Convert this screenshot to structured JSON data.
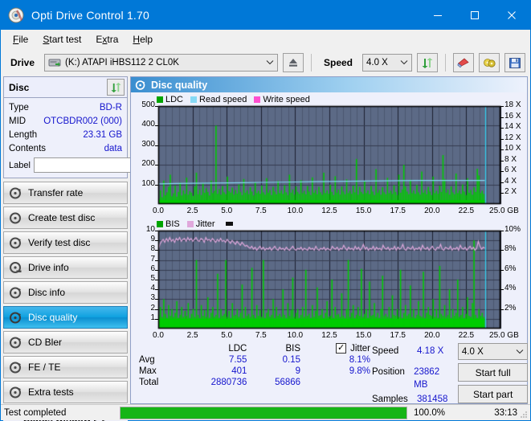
{
  "window": {
    "title": "Opti Drive Control 1.70",
    "icon": "disc-icon",
    "minimize": "–",
    "maximize": "☐",
    "close": "✕"
  },
  "menu": [
    {
      "label": "File",
      "accel": "F"
    },
    {
      "label": "Start test",
      "accel": "S"
    },
    {
      "label": "Extra",
      "accel": "x"
    },
    {
      "label": "Help",
      "accel": "H"
    }
  ],
  "toolbar": {
    "drive_label": "Drive",
    "drive_value": "(K:)  ATAPI iHBS112  2 CL0K",
    "eject_icon": "eject-icon",
    "speed_label": "Speed",
    "speed_value": "4.0 X",
    "refresh_icon": "refresh-icon",
    "eraser_icon": "eraser-icon",
    "disc_tools_icon": "disc-tools-icon",
    "save_icon": "save-icon",
    "caret": "⌄"
  },
  "disc_panel": {
    "title": "Disc",
    "refresh_icon": "refresh-icon",
    "rows": [
      {
        "key": "Type",
        "value": "BD-R"
      },
      {
        "key": "MID",
        "value": "OTCBDR002 (000)"
      },
      {
        "key": "Length",
        "value": "23.31 GB"
      },
      {
        "key": "Contents",
        "value": "data"
      }
    ],
    "label_key": "Label",
    "label_value": "",
    "label_placeholder": "",
    "label_button_icon": "disc-icon"
  },
  "nav": {
    "items": [
      {
        "label": "Transfer rate",
        "icon": "disc-transfer-icon",
        "active": false
      },
      {
        "label": "Create test disc",
        "icon": "disc-create-icon",
        "active": false
      },
      {
        "label": "Verify test disc",
        "icon": "disc-verify-icon",
        "active": false
      },
      {
        "label": "Drive info",
        "icon": "disc-drive-icon",
        "active": false
      },
      {
        "label": "Disc info",
        "icon": "disc-info-icon",
        "active": false
      },
      {
        "label": "Disc quality",
        "icon": "disc-quality-icon",
        "active": true
      },
      {
        "label": "CD Bler",
        "icon": "disc-bler-icon",
        "active": false
      },
      {
        "label": "FE / TE",
        "icon": "disc-fete-icon",
        "active": false
      },
      {
        "label": "Extra tests",
        "icon": "disc-extra-icon",
        "active": false
      }
    ],
    "status_window": "Status window > >"
  },
  "panel": {
    "title": "Disc quality",
    "icon": "disc-quality-icon"
  },
  "stats": {
    "columns": [
      "LDC",
      "BIS"
    ],
    "jitter_label": "Jitter",
    "jitter_checked": true,
    "jitter_check_glyph": "✓",
    "rows": [
      {
        "key": "Avg",
        "ldc": "7.55",
        "bis": "0.15",
        "jitter": "8.1%"
      },
      {
        "key": "Max",
        "ldc": "401",
        "bis": "9",
        "jitter": "9.8%"
      },
      {
        "key": "Total",
        "ldc": "2880736",
        "bis": "56866",
        "jitter": ""
      }
    ],
    "speed_key": "Speed",
    "speed_value": "4.18 X",
    "position_key": "Position",
    "position_value": "23862 MB",
    "samples_key": "Samples",
    "samples_value": "381458",
    "speed_select": "4.0 X",
    "speed_select_caret": "⌄",
    "start_full": "Start full",
    "start_part": "Start part"
  },
  "statusbar": {
    "text": "Test completed",
    "percent_label": "100.0%",
    "percent_value": 100,
    "time": "33:13",
    "bar_color": "#16b516"
  },
  "colors": {
    "accent": "#0078d7",
    "plot_bg": "#5c6a86",
    "grid": "#2c3242",
    "ldc": "#00cc00",
    "bis": "#00cc00",
    "read_speed": "#87d9f5",
    "write_speed": "#ff4fd0",
    "jitter": "#e0a8dc",
    "marker": "#30d0f0",
    "value_text": "#1515cd"
  },
  "chart_data": [
    {
      "type": "line",
      "name": "Disc quality - LDC / Read speed",
      "title": "",
      "xlabel": "GB",
      "ylabel": "LDC",
      "y2label": "X",
      "xlim": [
        0,
        25
      ],
      "ylim": [
        0,
        500
      ],
      "y2lim": [
        0,
        18
      ],
      "grid": true,
      "legend": [
        {
          "label": "LDC",
          "color": "#00a400"
        },
        {
          "label": "Read speed",
          "color": "#87d9f5"
        },
        {
          "label": "Write speed",
          "color": "#ff4fd0"
        }
      ],
      "xticks": [
        "0.0",
        "2.5",
        "5.0",
        "7.5",
        "10.0",
        "12.5",
        "15.0",
        "17.5",
        "20.0",
        "22.5",
        "25.0"
      ],
      "xtick_values": [
        0,
        2.5,
        5,
        7.5,
        10,
        12.5,
        15,
        17.5,
        20,
        22.5,
        25
      ],
      "x_unit": "GB",
      "yticks": [
        100,
        200,
        300,
        400,
        500
      ],
      "y2ticks": [
        2,
        4,
        6,
        8,
        10,
        12,
        14,
        16,
        18
      ],
      "y2tick_labels": [
        "2 X",
        "4 X",
        "6 X",
        "8 X",
        "10 X",
        "12 X",
        "14 X",
        "16 X",
        "18 X"
      ],
      "data_end_x": 23.86,
      "marker_x": 23.86,
      "series": [
        {
          "name": "LDC",
          "kind": "impulse",
          "color": "#00cc00",
          "x_start": 0,
          "x_end": 23.86,
          "baseline": 20,
          "values": [
            28,
            70,
            35,
            120,
            45,
            60,
            88,
            150,
            40,
            55,
            95,
            38,
            62,
            110,
            44,
            70,
            52,
            135,
            48,
            66,
            58,
            42,
            90,
            160,
            50,
            74,
            46,
            105,
            58,
            80,
            62,
            44,
            120,
            56,
            68,
            400,
            52,
            76,
            48,
            92,
            60,
            50,
            140,
            66,
            58,
            84,
            48,
            72,
            54,
            100,
            62,
            46,
            128,
            58,
            70,
            50,
            86,
            64,
            44,
            110,
            56,
            68,
            52,
            94,
            60,
            48,
            132,
            58,
            72,
            46,
            88,
            64,
            50,
            118,
            56,
            70,
            52,
            96,
            60,
            46,
            150,
            58,
            74,
            48,
            90,
            62,
            52,
            122,
            56,
            68,
            50,
            92,
            64,
            46,
            136,
            58,
            72,
            50,
            88,
            60,
            48,
            160,
            56,
            70,
            52,
            98,
            62,
            46,
            142,
            58,
            74,
            48,
            90,
            64,
            50,
            126,
            56,
            68,
            52,
            94,
            60,
            230,
            48,
            88,
            62,
            52,
            118,
            56,
            70,
            50,
            92,
            64,
            46,
            178,
            58,
            72,
            48,
            86,
            60,
            50,
            134,
            56,
            68,
            52,
            96,
            62,
            46,
            150,
            58,
            74,
            200,
            90,
            64,
            50,
            124,
            56,
            70,
            52,
            98,
            60,
            48,
            166,
            58,
            72,
            50,
            88,
            64,
            46,
            140,
            56,
            68,
            52,
            94,
            62,
            250,
            128,
            58,
            74,
            48,
            90,
            60,
            50,
            156,
            56,
            70,
            52,
            100,
            64,
            46,
            132,
            58,
            72,
            48,
            86,
            62,
            180,
            146,
            56,
            68,
            52
          ]
        },
        {
          "name": "Read speed",
          "kind": "line",
          "color": "#87d9f5",
          "x_start": 0,
          "x_end": 23.86,
          "values_x_units": [
            3.7,
            3.78,
            3.82,
            3.86,
            3.9,
            3.94,
            3.98,
            4.02,
            4.06,
            4.1,
            4.14,
            4.18,
            4.22,
            4.26,
            4.3,
            4.32,
            4.34,
            4.34,
            4.34,
            4.34
          ]
        },
        {
          "name": "Write speed",
          "kind": "line",
          "color": "#ff4fd0",
          "values": []
        }
      ]
    },
    {
      "type": "line",
      "name": "Disc quality - BIS / Jitter",
      "title": "",
      "xlabel": "GB",
      "ylabel": "BIS",
      "y2label": "%",
      "xlim": [
        0,
        25
      ],
      "ylim": [
        0,
        10
      ],
      "y2lim": [
        0,
        10
      ],
      "grid": true,
      "legend": [
        {
          "label": "BIS",
          "color": "#00a400"
        },
        {
          "label": "Jitter",
          "color": "#e0a8dc"
        }
      ],
      "xticks": [
        "0.0",
        "2.5",
        "5.0",
        "7.5",
        "10.0",
        "12.5",
        "15.0",
        "17.5",
        "20.0",
        "22.5",
        "25.0"
      ],
      "xtick_values": [
        0,
        2.5,
        5,
        7.5,
        10,
        12.5,
        15,
        17.5,
        20,
        22.5,
        25
      ],
      "x_unit": "GB",
      "yticks": [
        1,
        2,
        3,
        4,
        5,
        6,
        7,
        8,
        9,
        10
      ],
      "y2ticks": [
        2,
        4,
        6,
        8,
        10
      ],
      "y2tick_labels": [
        "2%",
        "4%",
        "6%",
        "8%",
        "10%"
      ],
      "data_end_x": 23.86,
      "marker_x": 23.86,
      "series": [
        {
          "name": "BIS",
          "kind": "impulse",
          "color": "#00cc00",
          "x_start": 0,
          "x_end": 23.86,
          "baseline": 1.0,
          "values": [
            1.4,
            2.2,
            1.2,
            3.0,
            1.5,
            1.1,
            2.4,
            1.3,
            2.0,
            1.2,
            1.6,
            2.8,
            1.1,
            1.4,
            2.2,
            1.2,
            1.8,
            1.3,
            2.6,
            1.1,
            1.5,
            2.0,
            1.2,
            7.0,
            1.4,
            1.1,
            2.4,
            1.3,
            1.9,
            1.2,
            3.2,
            1.1,
            1.6,
            2.2,
            1.2,
            1.4,
            5.6,
            1.1,
            2.0,
            1.3,
            1.5,
            7.0,
            1.2,
            1.8,
            1.1,
            2.6,
            1.3,
            1.4,
            2.0,
            1.2,
            1.6,
            4.5,
            1.1,
            2.2,
            1.3,
            1.5,
            1.2,
            6.2,
            1.4,
            1.1,
            2.4,
            1.3,
            1.9,
            1.2,
            7.0,
            1.1,
            1.6,
            2.0,
            1.2,
            1.4,
            3.0,
            1.1,
            2.2,
            1.3,
            1.5,
            1.2,
            4.0,
            1.4,
            1.1,
            2.6,
            1.3,
            1.9,
            5.2,
            1.2,
            1.6,
            2.0,
            1.1,
            1.4,
            2.2,
            1.2,
            6.0,
            1.3,
            1.5,
            1.1,
            2.4,
            1.2,
            1.8,
            4.2,
            1.3,
            1.4,
            2.0,
            1.1,
            1.6,
            2.8,
            1.2,
            1.3,
            5.0,
            1.1,
            2.2,
            1.4,
            1.5,
            1.2,
            3.6,
            1.3,
            1.1,
            2.0,
            7.0,
            1.2,
            1.6,
            2.4,
            1.1,
            1.4,
            2.2,
            1.3,
            6.1,
            1.2,
            1.5,
            2.0,
            1.1,
            4.8,
            1.3,
            1.4,
            2.6,
            1.2,
            1.6,
            1.1,
            2.0,
            5.4,
            1.3,
            1.5,
            1.2,
            2.2,
            1.1,
            3.4,
            1.4,
            1.3,
            2.0,
            1.2,
            6.0,
            1.1,
            1.6,
            2.4,
            1.3,
            1.5,
            4.4,
            1.2,
            2.0,
            1.1,
            1.4,
            2.8,
            1.3,
            1.2,
            5.8,
            1.1,
            1.6,
            2.2,
            1.4,
            1.3,
            3.0,
            1.2,
            2.0,
            1.1,
            6.4,
            1.5,
            1.3,
            2.4,
            1.2,
            1.4,
            4.0,
            1.1,
            2.0,
            1.3,
            1.6,
            5.0,
            1.2,
            1.4,
            2.2,
            1.1,
            1.5,
            3.2,
            1.3,
            1.2,
            2.6,
            9.0,
            1.4,
            1.1,
            2.0,
            1.3,
            1.6,
            1.2
          ]
        },
        {
          "name": "Jitter",
          "kind": "line",
          "color": "#e0a8dc",
          "x_start": 0,
          "x_end": 23.86,
          "values": [
            8.0,
            8.6,
            8.9,
            9.1,
            8.8,
            9.2,
            8.9,
            9.3,
            8.9,
            9.1,
            8.8,
            9.2,
            9.0,
            9.3,
            8.9,
            9.1,
            9.2,
            8.9,
            9.3,
            9.0,
            9.2,
            8.9,
            9.1,
            9.3,
            9.0,
            8.9,
            9.2,
            9.1,
            8.8,
            9.3,
            9.0,
            9.1,
            8.9,
            9.2,
            9.0,
            8.8,
            9.1,
            8.9,
            9.2,
            8.9,
            9.0,
            8.8,
            9.1,
            8.9,
            8.7,
            9.0,
            8.8,
            8.6,
            8.9,
            8.7,
            8.5,
            8.8,
            8.6,
            8.4,
            8.5,
            8.3,
            8.2,
            8.4,
            8.1,
            8.3,
            8.0,
            8.2,
            8.4,
            8.1,
            8.3,
            8.0,
            8.2,
            8.1,
            8.3,
            8.0,
            8.2,
            8.4,
            8.1,
            8.0,
            8.3,
            8.1,
            8.2,
            8.0,
            8.3,
            8.1,
            8.0,
            8.2,
            8.4,
            8.1,
            8.0,
            8.2,
            8.1,
            8.3,
            8.0,
            8.2,
            8.1,
            8.0,
            8.3,
            8.1,
            8.2,
            8.0,
            8.4,
            8.1,
            8.0,
            8.2,
            8.1,
            8.3,
            8.0,
            8.2,
            8.1,
            8.0,
            8.4,
            8.2,
            8.1,
            8.3,
            8.0,
            8.2,
            8.1,
            8.5,
            8.2,
            8.0,
            8.3,
            8.1,
            8.2,
            8.0,
            8.4,
            8.1,
            8.3,
            8.0,
            8.2,
            8.6,
            8.1,
            8.3,
            8.0,
            8.2,
            8.1,
            8.4,
            8.0,
            8.3,
            8.1,
            8.2,
            8.0,
            8.5,
            8.2,
            8.1,
            8.3,
            8.0,
            8.2,
            8.1,
            8.4,
            8.0,
            8.3,
            8.1,
            8.2,
            8.6,
            8.1,
            8.0,
            8.3,
            8.2,
            8.1,
            8.4,
            8.0,
            8.2,
            8.1,
            8.3,
            8.0,
            8.5,
            8.2,
            8.1,
            8.3,
            8.0,
            8.2,
            8.4,
            8.1,
            8.0,
            8.3,
            8.2,
            8.6,
            8.1,
            8.0,
            8.3,
            8.2,
            8.1,
            8.4,
            8.0,
            8.2,
            8.1,
            8.3,
            8.0,
            8.5,
            8.2,
            8.1,
            8.3,
            8.0,
            8.2,
            8.4,
            8.1,
            8.3,
            8.0,
            8.2,
            8.9,
            8.4,
            8.1,
            8.3,
            8.2
          ]
        }
      ]
    }
  ]
}
